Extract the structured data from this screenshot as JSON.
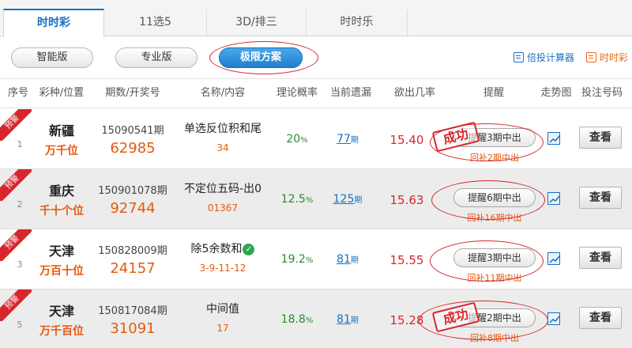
{
  "tabs": [
    {
      "label": "时时彩",
      "active": true
    },
    {
      "label": "11选5",
      "active": false
    },
    {
      "label": "3D/排三",
      "active": false
    },
    {
      "label": "时时乐",
      "active": false
    }
  ],
  "toolbar": {
    "buttons": [
      {
        "label": "智能版"
      },
      {
        "label": "专业版"
      },
      {
        "label": "极限方案",
        "primary": true
      }
    ],
    "calc_link": "倍投计算器",
    "ssc_link": "时时彩"
  },
  "headers": [
    "序号",
    "彩种/位置",
    "期数/开奖号",
    "名称/内容",
    "理论概率",
    "当前遗漏",
    "欲出几率",
    "提醒",
    "走势图",
    "投注号码"
  ],
  "rows": [
    {
      "ribbon": "预警",
      "index": "1",
      "region": "新疆",
      "position": "万千位",
      "period": "15090541期",
      "draw": "62985",
      "name": "单选反位积和尾",
      "content": "34",
      "prob": "20",
      "prob_unit": "%",
      "miss": "77",
      "miss_unit": "期",
      "odds": "15.40",
      "stamp": "成功",
      "remind": "提醒3期中出",
      "bu": "回补2期中出",
      "view": "查看"
    },
    {
      "ribbon": "预警",
      "index": "2",
      "region": "重庆",
      "position": "千十个位",
      "period": "150901078期",
      "draw": "92744",
      "name": "不定位五码-出0",
      "content": "01367",
      "prob": "12.5",
      "prob_unit": "%",
      "miss": "125",
      "miss_unit": "期",
      "odds": "15.63",
      "stamp": "",
      "remind": "提醒6期中出",
      "bu": "回补16期中出",
      "view": "查看"
    },
    {
      "ribbon": "预警",
      "index": "3",
      "region": "天津",
      "position": "万百十位",
      "period": "150828009期",
      "draw": "24157",
      "name": "除5余数和",
      "content": "3-9-11-12",
      "prob": "19.2",
      "prob_unit": "%",
      "miss": "81",
      "miss_unit": "期",
      "odds": "15.55",
      "stamp": "",
      "remind": "提醒3期中出",
      "bu": "回补11期中出",
      "view": "查看"
    },
    {
      "ribbon": "预警",
      "index": "5",
      "region": "天津",
      "position": "万千百位",
      "period": "150817084期",
      "draw": "31091",
      "name": "中间值",
      "content": "17",
      "prob": "18.8",
      "prob_unit": "%",
      "miss": "81",
      "miss_unit": "期",
      "odds": "15.28",
      "stamp": "成功",
      "remind": "提醒2期中出",
      "bu": "回补8期中出",
      "view": "查看"
    }
  ],
  "colors": {
    "accent": "#1a6fc4",
    "orange": "#e8590c",
    "red": "#d8262c",
    "green": "#2e8b2e"
  },
  "icons": [
    "calculator-icon",
    "calendar-icon",
    "trend-chart-icon",
    "check-shield-icon"
  ]
}
